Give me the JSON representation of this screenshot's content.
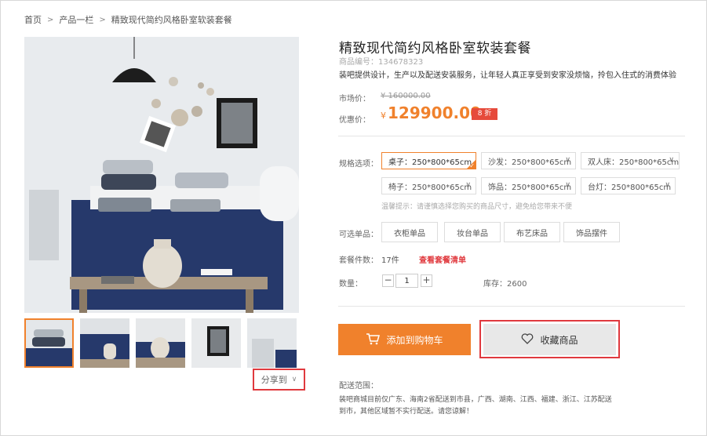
{
  "breadcrumb": {
    "home": "首页",
    "category": "产品一栏",
    "current": "精致现代简约风格卧室软装套餐"
  },
  "product": {
    "title": "精致现代简约风格卧室软装套餐",
    "sku": "商品编号：134678323",
    "description": "装吧提供设计，生产以及配送安装服务，让年轻人真正享受到安家没烦恼，拎包入住式的消费体验"
  },
  "price": {
    "market_label": "市场价：",
    "market_value": "¥ 160000.00",
    "promo_label": "优惠价：",
    "currency": "¥",
    "promo_value": "129900.00",
    "discount": "8 折"
  },
  "specs": {
    "label": "规格选项：",
    "items": [
      {
        "text": "桌子：250*800*65cm",
        "selected": true
      },
      {
        "text": "沙发：250*800*65cm"
      },
      {
        "text": "双人床：250*800*65cm"
      },
      {
        "text": "椅子：250*800*65cm"
      },
      {
        "text": "饰品：250*800*65cm"
      },
      {
        "text": "台灯：250*800*65cm"
      }
    ],
    "hint": "温馨提示：请谨慎选择您购买的商品尺寸，避免给您带来不便"
  },
  "options": {
    "label": "可选单品：",
    "items": [
      "衣柜单品",
      "妆台单品",
      "布艺床品",
      "饰品摆件"
    ]
  },
  "package": {
    "label": "套餐件数：",
    "count": "17件",
    "link": "查看套餐清单"
  },
  "quantity": {
    "label": "数量：",
    "minus": "−",
    "value": "1",
    "plus": "+",
    "stock": "库存：2600"
  },
  "actions": {
    "add_to_cart": "添加到购物车",
    "favorite": "收藏商品"
  },
  "share": {
    "label": "分享到"
  },
  "shipping": {
    "label": "配送范围：",
    "text": "装吧商城目前仅广东、海南2省配送到市县，广西、湖南、江西、福建、浙江、江苏配送到市，其他区域暂不实行配送。请您谅解！"
  },
  "colors": {
    "accent": "#f0812c",
    "highlight_border": "#e0393e",
    "discount_bg": "#e64a3b",
    "bedding_navy": "#26396b"
  }
}
